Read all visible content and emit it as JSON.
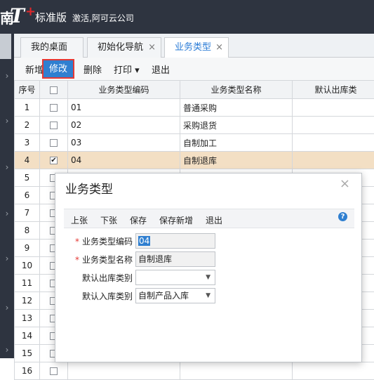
{
  "app": {
    "logo_edge": "南",
    "logo_t": "T",
    "logo_plus": "+",
    "edition": "标准版",
    "activation": "激活,阿可云公司"
  },
  "sidebar": {
    "chevron": "›"
  },
  "tabs": [
    {
      "label": "我的桌面",
      "closable": false
    },
    {
      "label": "初始化导航",
      "closable": true
    },
    {
      "label": "业务类型",
      "closable": true,
      "active": true
    }
  ],
  "tab_close_glyph": "×",
  "toolbar": {
    "add": "新增",
    "edit": "修改",
    "delete": "删除",
    "print": "打印",
    "print_arrow": "▾",
    "exit": "退出"
  },
  "grid": {
    "columns": [
      "序号",
      "",
      "业务类型编码",
      "业务类型名称",
      "默认出库类"
    ],
    "rows": [
      {
        "no": "1",
        "checked": false,
        "code": "01",
        "name": "普通采购"
      },
      {
        "no": "2",
        "checked": false,
        "code": "02",
        "name": "采购退货"
      },
      {
        "no": "3",
        "checked": false,
        "code": "03",
        "name": "自制加工"
      },
      {
        "no": "4",
        "checked": true,
        "code": "04",
        "name": "自制退库"
      },
      {
        "no": "5",
        "checked": false,
        "code": "",
        "name": ""
      },
      {
        "no": "6",
        "checked": false,
        "code": "",
        "name": ""
      },
      {
        "no": "7",
        "checked": false,
        "code": "",
        "name": ""
      },
      {
        "no": "8",
        "checked": false,
        "code": "",
        "name": ""
      },
      {
        "no": "9",
        "checked": false,
        "code": "",
        "name": ""
      },
      {
        "no": "10",
        "checked": false,
        "code": "",
        "name": ""
      },
      {
        "no": "11",
        "checked": false,
        "code": "",
        "name": ""
      },
      {
        "no": "12",
        "checked": false,
        "code": "",
        "name": ""
      },
      {
        "no": "13",
        "checked": false,
        "code": "",
        "name": ""
      },
      {
        "no": "14",
        "checked": false,
        "code": "",
        "name": ""
      },
      {
        "no": "15",
        "checked": false,
        "code": "",
        "name": ""
      },
      {
        "no": "16",
        "checked": false,
        "code": "",
        "name": ""
      }
    ]
  },
  "dialog": {
    "title": "业务类型",
    "close": "×",
    "toolbar": {
      "prev": "上张",
      "next": "下张",
      "save": "保存",
      "save_new": "保存新增",
      "exit": "退出",
      "help": "?"
    },
    "required_mark": "*",
    "fields": {
      "code_label": "业务类型编码",
      "code_value": "04",
      "name_label": "业务类型名称",
      "name_value": "自制退库",
      "out_label": "默认出库类别",
      "out_value": "",
      "in_label": "默认入库类别",
      "in_value": "自制产品入库"
    },
    "dropdown_arrow": "▼"
  }
}
